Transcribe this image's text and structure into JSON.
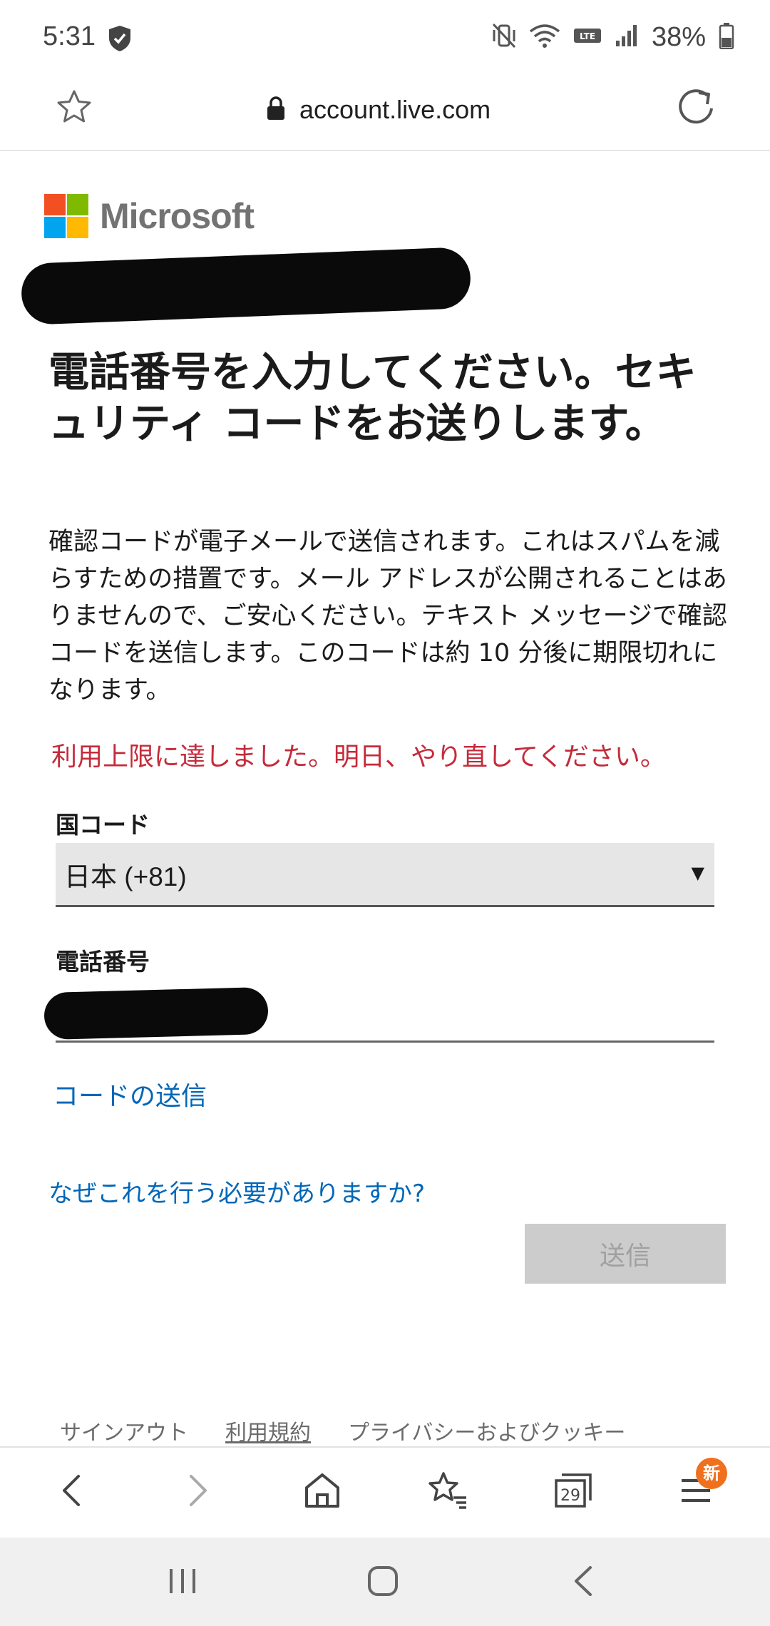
{
  "status_bar": {
    "time": "5:31",
    "battery_percent": "38%",
    "icons": [
      "shield-icon",
      "mute-vibrate-icon",
      "wifi-icon",
      "volte-icon",
      "signal-icon",
      "battery-icon"
    ]
  },
  "browser": {
    "url": "account.live.com",
    "tab_count": "29",
    "menu_badge": "新"
  },
  "page": {
    "brand": "Microsoft",
    "heading": "電話番号を入力してください。セキュリティ コードをお送りします。",
    "description": "確認コードが電子メールで送信されます。これはスパムを減らすための措置です。メール アドレスが公開されることはありませんので、ご安心ください。テキスト メッセージで確認コードを送信します。このコードは約 10 分後に期限切れになります。",
    "error": "利用上限に達しました。明日、やり直してください。",
    "country_label": "国コード",
    "country_value": "日本 (+81)",
    "phone_label": "電話番号",
    "send_code_link": "コードの送信",
    "why_link": "なぜこれを行う必要がありますか?",
    "submit_label": "送信",
    "footer": {
      "sign_out": "サインアウト",
      "terms": "利用規約",
      "privacy": "プライバシーおよびクッキー"
    }
  },
  "colors": {
    "ms_red": "#f25022",
    "ms_green": "#7fba00",
    "ms_blue": "#00a4ef",
    "ms_yellow": "#ffb900",
    "link": "#0067b8",
    "error": "#c42b3a",
    "badge": "#f0701e"
  }
}
